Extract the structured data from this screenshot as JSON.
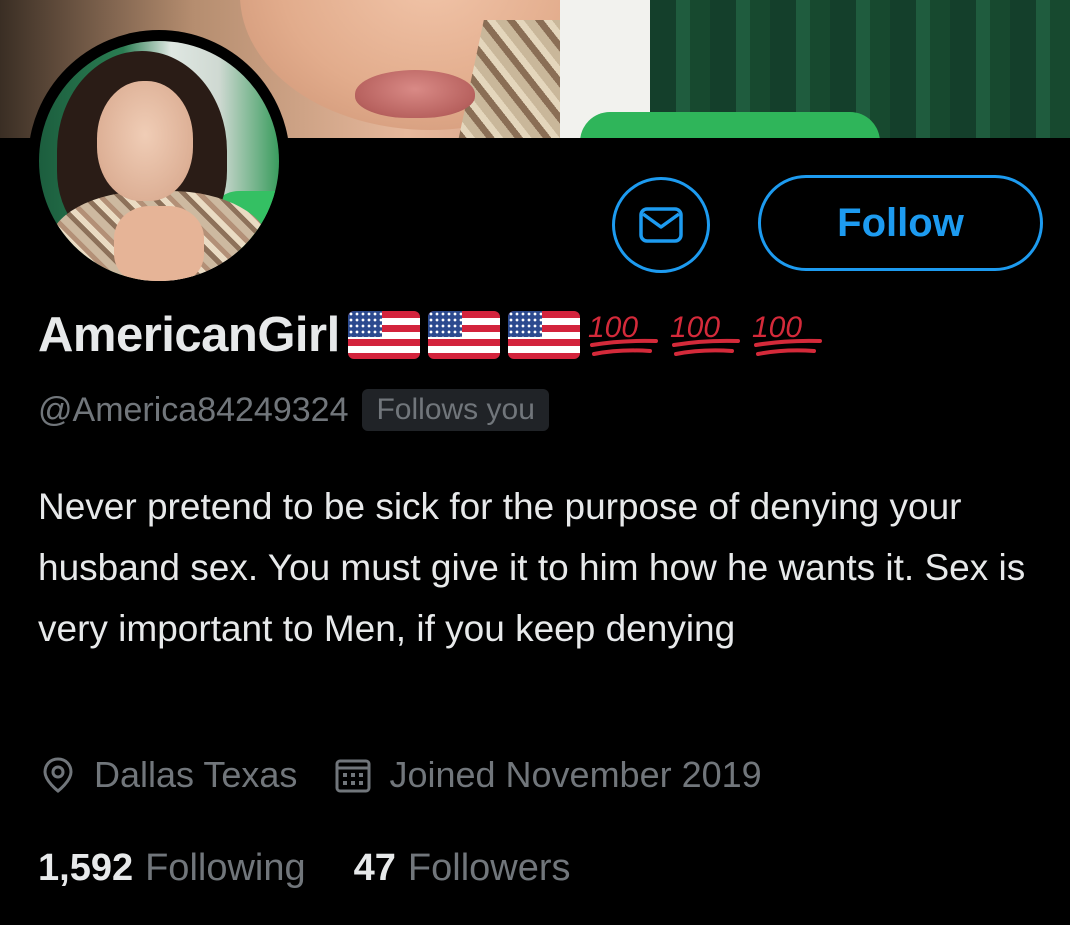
{
  "profile": {
    "display_name": "AmericanGirl",
    "name_emojis": [
      "us-flag",
      "us-flag",
      "us-flag",
      "hundred-points",
      "hundred-points",
      "hundred-points"
    ],
    "handle": "@America84249324",
    "follows_you_badge": "Follows you",
    "bio": "Never pretend to be sick for the purpose of denying your husband sex. You must give it to him how he wants it. Sex is very important to Men, if you keep denying",
    "location": "Dallas Texas",
    "joined": "Joined November 2019",
    "following_count": "1,592",
    "following_label": "Following",
    "followers_count": "47",
    "followers_label": "Followers"
  },
  "actions": {
    "message_icon": "mail-icon",
    "follow_label": "Follow"
  },
  "icons": {
    "location": "location-pin-icon",
    "calendar": "calendar-icon"
  },
  "colors": {
    "background": "#000000",
    "accent": "#1d9bf0",
    "primary_text": "#e7e9ea",
    "secondary_text": "#71767b",
    "hundred_red": "#d42a3a"
  }
}
